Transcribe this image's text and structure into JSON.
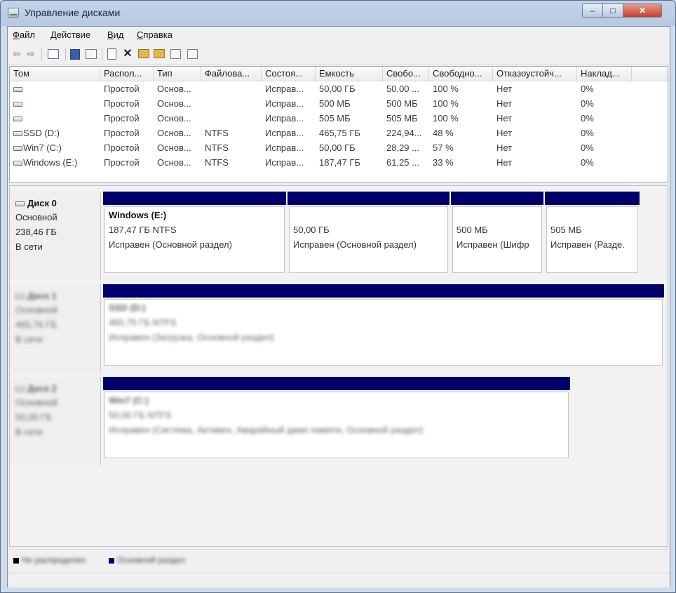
{
  "window": {
    "title": "Управление дисками",
    "minimize_glyph": "–",
    "maximize_glyph": "□",
    "close_glyph": "✕"
  },
  "menu": [
    "Файл",
    "Действие",
    "Вид",
    "Справка"
  ],
  "toolbar": [
    "back-icon",
    "forward-icon",
    "console-tree-icon",
    "properties-icon",
    "help-icon",
    "view-icon",
    "refresh-icon",
    "delete-icon",
    "volume-icon",
    "open-icon",
    "search-icon",
    "export-icon"
  ],
  "volumes": {
    "columns": [
      "Том",
      "Распол...",
      "Тип",
      "Файлова...",
      "Состоя...",
      "Емкость",
      "Свобо...",
      "Свободно...",
      "Отказоустойч...",
      "Наклад..."
    ],
    "rows": [
      [
        "",
        "Простой",
        "Основ...",
        "",
        "Исправ...",
        "50,00 ГБ",
        "50,00 ...",
        "100 %",
        "Нет",
        "0%"
      ],
      [
        "",
        "Простой",
        "Основ...",
        "",
        "Исправ...",
        "500 МБ",
        "500 МБ",
        "100 %",
        "Нет",
        "0%"
      ],
      [
        "",
        "Простой",
        "Основ...",
        "",
        "Исправ...",
        "505 МБ",
        "505 МБ",
        "100 %",
        "Нет",
        "0%"
      ],
      [
        "SSD (D:)",
        "Простой",
        "Основ...",
        "NTFS",
        "Исправ...",
        "465,75 ГБ",
        "224,94...",
        "48 %",
        "Нет",
        "0%"
      ],
      [
        "Win7 (C:)",
        "Простой",
        "Основ...",
        "NTFS",
        "Исправ...",
        "50,00 ГБ",
        "28,29 ...",
        "57 %",
        "Нет",
        "0%"
      ],
      [
        "Windows (E:)",
        "Простой",
        "Основ...",
        "NTFS",
        "Исправ...",
        "187,47 ГБ",
        "61,25 ...",
        "33 %",
        "Нет",
        "0%"
      ]
    ]
  },
  "disk0": {
    "title": "Диск 0",
    "type": "Основной",
    "size": "238,46 ГБ",
    "status": "В сети",
    "partitions": [
      {
        "name": "Windows  (E:)",
        "size": "187,47 ГБ NTFS",
        "status": "Исправен (Основной раздел)"
      },
      {
        "name": "",
        "size": "50,00 ГБ",
        "status": "Исправен (Основной раздел)"
      },
      {
        "name": "",
        "size": "500 МБ",
        "status": "Исправен (Шифр"
      },
      {
        "name": "",
        "size": "505 МБ",
        "status": "Исправен (Разде."
      }
    ]
  },
  "disk1": {
    "title": "Диск 1",
    "type": "Основной",
    "size": "465,76 ГБ",
    "status": "В сети",
    "partition": {
      "name": "SSD (D:)",
      "size": "465,75 ГБ NTFS",
      "status": "Исправен (Загрузка, Основной раздел)"
    }
  },
  "disk2": {
    "title": "Диск 2",
    "type": "Основной",
    "size": "50,00 ГБ",
    "status": "В сети",
    "partition": {
      "name": "Win7 (C:)",
      "size": "50,00 ГБ NTFS",
      "status": "Исправен (Система, Активен, Аварийный дамп памяти, Основной раздел)"
    }
  },
  "legend": [
    {
      "label": "Не распределен",
      "color": "#000000"
    },
    {
      "label": "Основной раздел",
      "color": "#00006a"
    }
  ]
}
